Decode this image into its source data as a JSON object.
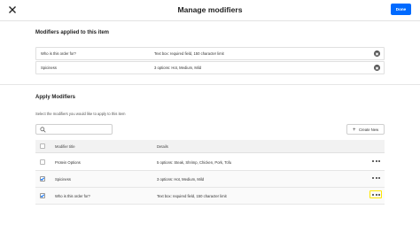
{
  "header": {
    "title": "Manage modifiers",
    "done_label": "Done"
  },
  "applied": {
    "title": "Modifiers applied to this item",
    "rows": [
      {
        "name": "Who is this order for?",
        "detail": "Text box: required field, 150 character limit"
      },
      {
        "name": "Spiciness",
        "detail": "3 options: Hot, Medium, Mild"
      }
    ]
  },
  "apply": {
    "title": "Apply Modifiers",
    "helper": "Select the modifiers you would like to apply to this item",
    "search_placeholder": "",
    "create_label": "Create New",
    "columns": {
      "title": "Modifier title",
      "details": "Details"
    },
    "rows": [
      {
        "title": "Protein Options",
        "details": "5 options: Steak, Shrimp, Chicken, Pork, Tofu",
        "checked": false
      },
      {
        "title": "Spiciness",
        "details": "3 options: Hot, Medium, Mild",
        "checked": true
      },
      {
        "title": "Who is this order for?",
        "details": "Text box: required field, 150 character limit",
        "checked": true,
        "menu_focused": true
      }
    ]
  },
  "colors": {
    "accent": "#006aff",
    "focus_ring": "#ffe600"
  }
}
